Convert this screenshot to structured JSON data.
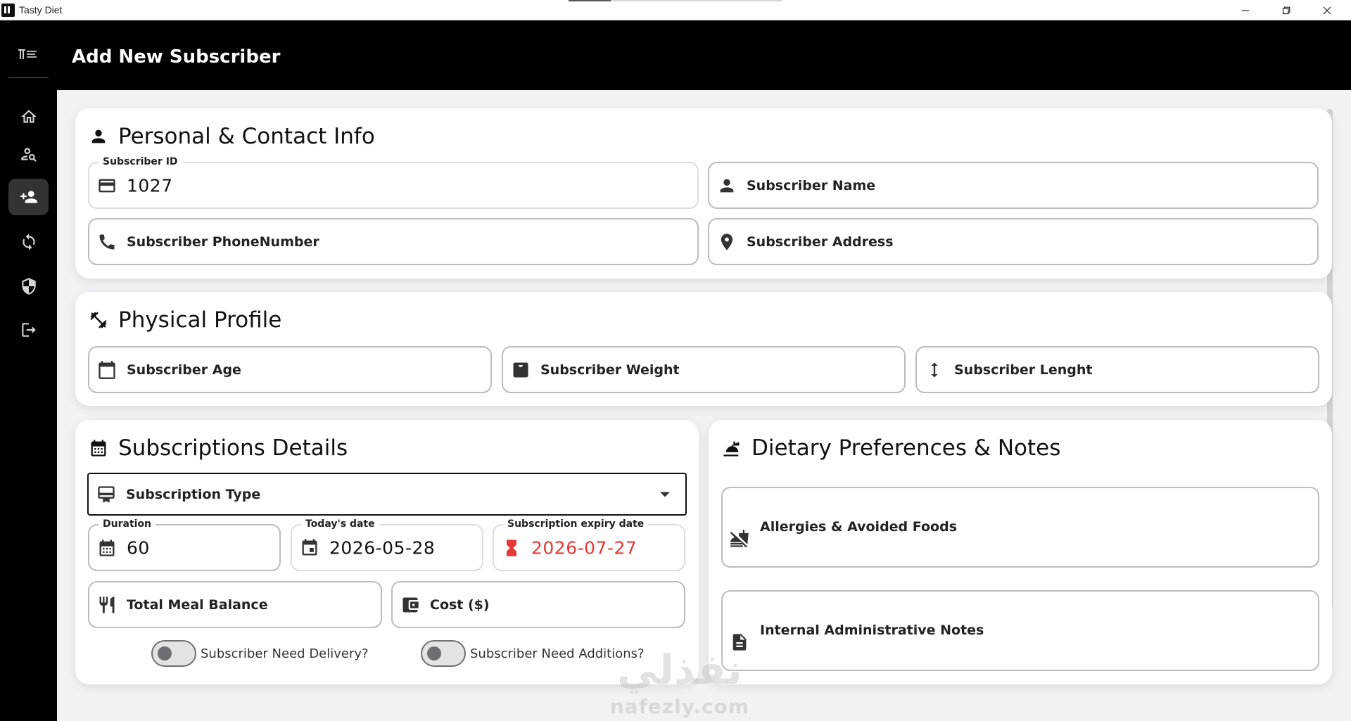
{
  "window": {
    "title": "Tasty Diet"
  },
  "header": {
    "title": "Add New Subscriber"
  },
  "sidebar": {
    "items": [
      {
        "name": "home",
        "icon": "home-icon"
      },
      {
        "name": "search-subscriber",
        "icon": "person-search-icon"
      },
      {
        "name": "add-subscriber",
        "icon": "person-add-icon",
        "active": true
      },
      {
        "name": "renew",
        "icon": "sync-icon"
      },
      {
        "name": "security",
        "icon": "shield-icon"
      },
      {
        "name": "logout",
        "icon": "logout-icon"
      }
    ]
  },
  "personal": {
    "title": "Personal & Contact Info",
    "id_label": "Subscriber ID",
    "id_value": "1027",
    "name_placeholder": "Subscriber Name",
    "phone_placeholder": "Subscriber PhoneNumber",
    "address_placeholder": "Subscriber Address"
  },
  "physical": {
    "title": "Physical Profile",
    "age_placeholder": "Subscriber Age",
    "weight_placeholder": "Subscriber Weight",
    "length_placeholder": "Subscriber Lenght"
  },
  "subscription": {
    "title": "Subscriptions Details",
    "type_placeholder": "Subscription Type",
    "duration_label": "Duration",
    "duration_value": "60",
    "today_label": "Today's date",
    "today_value": "2026-05-28",
    "expiry_label": "Subscription expiry date",
    "expiry_value": "2026-07-27",
    "meal_placeholder": "Total Meal Balance",
    "cost_placeholder": "Cost ($)",
    "delivery_label": "Subscriber Need Delivery?",
    "delivery_on": false,
    "additions_label": "Subscriber Need Additions?",
    "additions_on": false
  },
  "dietary": {
    "title": "Dietary Preferences & Notes",
    "allergies_placeholder": "Allergies & Avoided Foods",
    "notes_placeholder": "Internal Administrative Notes"
  },
  "watermark": {
    "arabic": "نفذلي",
    "latin": "nafezly.com"
  },
  "colors": {
    "accent_red": "#e53935",
    "header_bg": "#000000",
    "sidebar_bg": "#000000"
  }
}
